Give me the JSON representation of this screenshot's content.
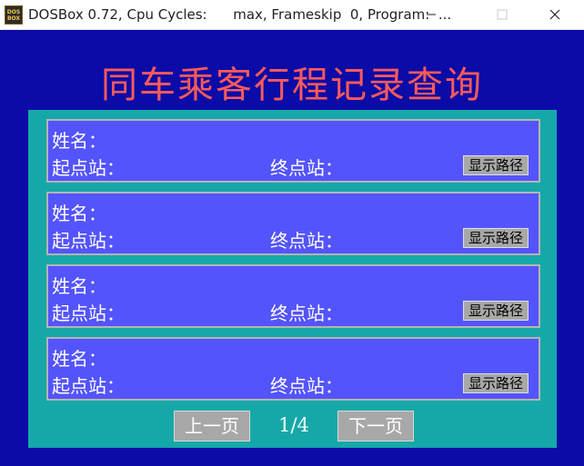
{
  "window": {
    "title": "DOSBox 0.72, Cpu Cycles:      max, Frameskip  0, Program:  ...",
    "icon": "dosbox-icon",
    "icon_text": [
      "DOS",
      "BOX"
    ],
    "controls": [
      "minimize-icon",
      "maximize-icon",
      "close-icon"
    ]
  },
  "page": {
    "heading": "同车乘客行程记录查询",
    "colors": {
      "background": "#0b0ba8",
      "panel": "#16a8a8",
      "record": "#5454fc",
      "heading": "#ff5a5a",
      "button": "#a8a8a8"
    }
  },
  "records": [
    {
      "name_label": "姓名：",
      "start_label": "起点站：",
      "end_label": "终点站：",
      "route_button": "显示路径"
    },
    {
      "name_label": "姓名：",
      "start_label": "起点站：",
      "end_label": "终点站：",
      "route_button": "显示路径"
    },
    {
      "name_label": "姓名：",
      "start_label": "起点站：",
      "end_label": "终点站：",
      "route_button": "显示路径"
    },
    {
      "name_label": "姓名：",
      "start_label": "起点站：",
      "end_label": "终点站：",
      "route_button": "显示路径"
    }
  ],
  "pagination": {
    "prev_label": "上一页",
    "page_indicator": "1/4",
    "next_label": "下一页"
  }
}
